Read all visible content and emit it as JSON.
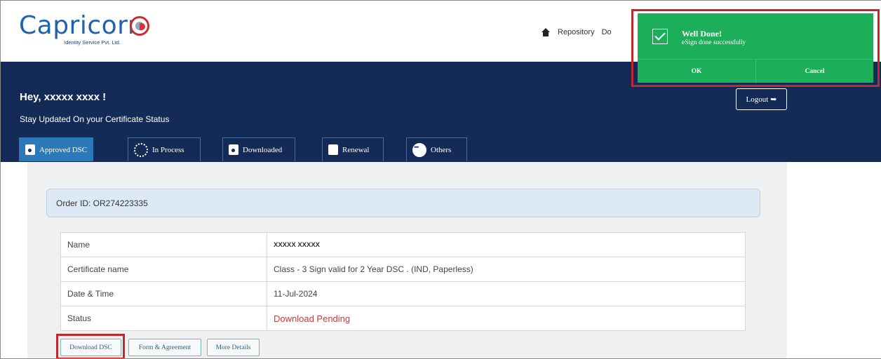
{
  "header": {
    "logo_text": "Capricorn",
    "logo_subtitle": "Identity Service Pvt. Ltd.",
    "nav": {
      "home_icon": "home-icon",
      "repository": "Repository",
      "cut_off_item": "Do"
    }
  },
  "banner": {
    "greeting": "Hey, xxxxx xxxx !",
    "subtitle": "Stay Updated On your Certificate Status",
    "logout_label": "Logout",
    "logout_icon_glyph": "➥"
  },
  "tabs": [
    {
      "label": "Approved DSC",
      "active": true,
      "icon": "document-icon"
    },
    {
      "label": "In Process",
      "active": false,
      "icon": "clock-icon"
    },
    {
      "label": "Downloaded",
      "active": false,
      "icon": "download-document-icon"
    },
    {
      "label": "Renewal",
      "active": false,
      "icon": "file-icon"
    },
    {
      "label": "Others",
      "active": false,
      "icon": "more-icon"
    }
  ],
  "order": {
    "order_id": "Order ID: OR274223335",
    "rows": [
      {
        "label": "Name",
        "value": "XXXXX XXXXX"
      },
      {
        "label": "Certificate name",
        "value": "Class - 3 Sign valid for 2 Year DSC . (IND, Paperless)"
      },
      {
        "label": "Date & Time",
        "value": "11-Jul-2024"
      },
      {
        "label": "Status",
        "value": "Download Pending"
      }
    ],
    "buttons": {
      "download": "Download DSC",
      "form": "Form & Agreement",
      "more": "More Details"
    }
  },
  "toast": {
    "title": "Well Done!",
    "message": "eSign done successfully",
    "ok": "OK",
    "cancel": "Cancel"
  },
  "colors": {
    "brand_blue": "#1f63b0",
    "banner_navy": "#142b57",
    "active_tab": "#2c79b8",
    "toast_green": "#1dae5a",
    "status_pending": "#c43c3c",
    "highlight_red": "#c1272d"
  }
}
